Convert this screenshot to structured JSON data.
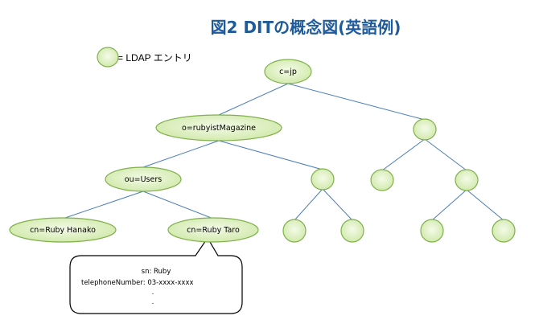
{
  "title": "図2 DITの概念図(英語例)",
  "legend": {
    "label": "= LDAP エントリ"
  },
  "nodes": {
    "root": "c=jp",
    "org": "o=rubyistMagazine",
    "ou": "ou=Users",
    "cn1": "cn=Ruby Hanako",
    "cn2": "cn=Ruby Taro"
  },
  "callout": {
    "line1": "sn:   Ruby",
    "line2": "telephoneNumber: 03-xxxx-xxxx",
    "line3": "."
  },
  "colors": {
    "node_fill_center": "#f2fbe4",
    "node_fill_edge": "#cfe8a8",
    "node_stroke": "#7fb04a",
    "edge": "#4a7ebb",
    "title": "#1f5b9b"
  }
}
